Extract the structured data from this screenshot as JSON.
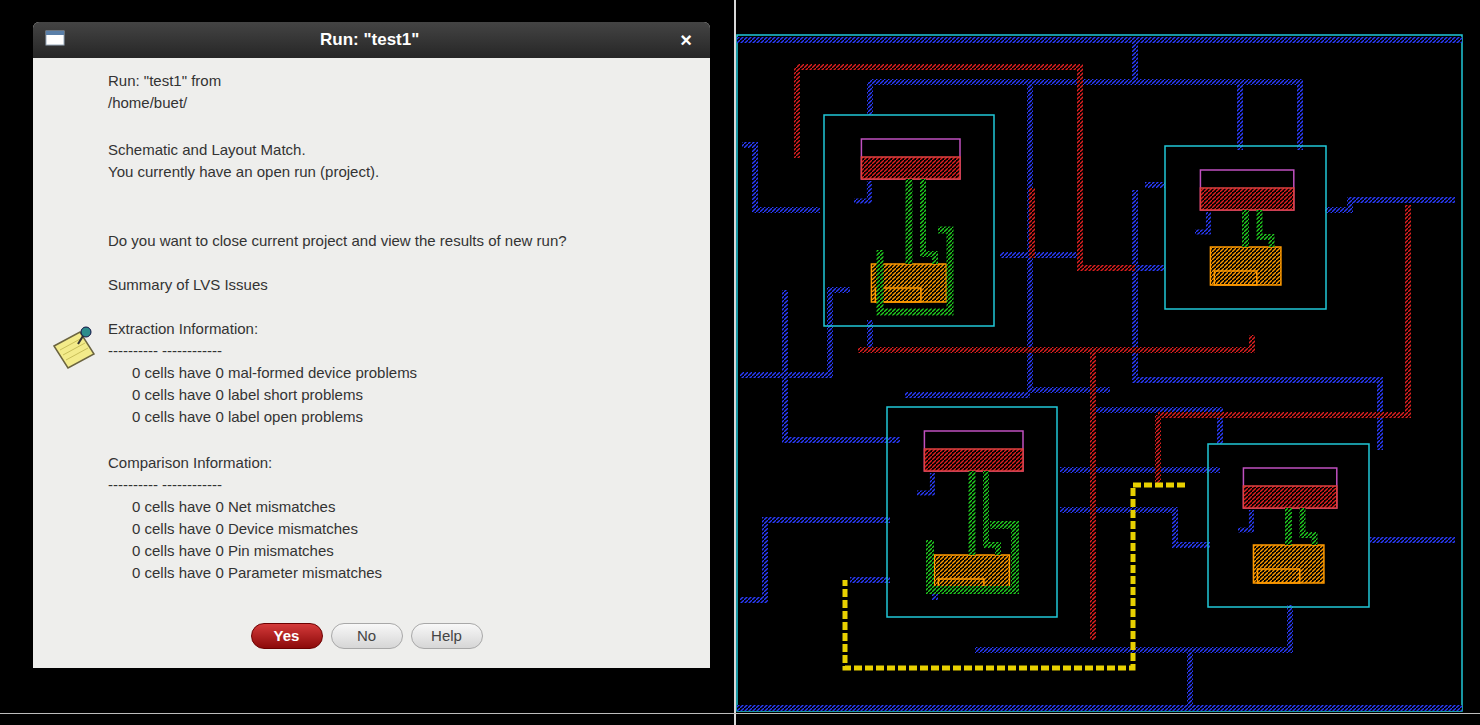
{
  "window": {
    "title": "Run: \"test1\"",
    "close": "×"
  },
  "header": [
    "Run: \"test1\"  from",
    "/home/buet/"
  ],
  "status": [
    "Schematic and Layout Match.",
    "You currently have an open run (project)."
  ],
  "question": "Do you want to close current project and view the results of new run?",
  "summary": "Summary of LVS Issues",
  "extraction": {
    "title": "Extraction Information:",
    "separator": "---------- ------------",
    "items": [
      "0 cells have 0 mal-formed device problems",
      "0 cells have 0 label short problems",
      "0 cells have 0 label open problems"
    ]
  },
  "comparison": {
    "title": "Comparison Information:",
    "separator": "---------- ------------",
    "items": [
      "0 cells have 0 Net mismatches",
      "0 cells have 0 Device mismatches",
      "0 cells have 0 Pin mismatches",
      "0 cells have 0 Parameter mismatches"
    ]
  },
  "buttons": [
    {
      "label": "Yes",
      "selected": true
    },
    {
      "label": "No",
      "selected": false
    },
    {
      "label": "Help",
      "selected": false
    }
  ]
}
